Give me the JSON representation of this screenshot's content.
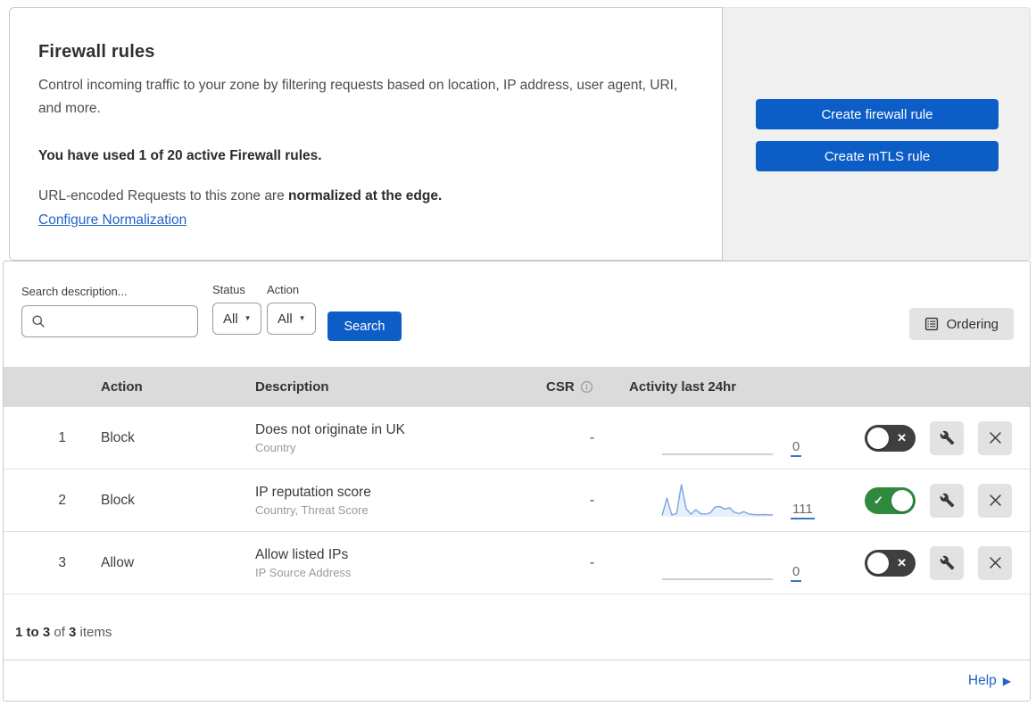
{
  "intro": {
    "title": "Firewall rules",
    "description": "Control incoming traffic to your zone by filtering requests based on location, IP address, user agent, URI, and more.",
    "usage_bold": "You have used 1 of 20 active Firewall rules.",
    "normalization_prefix": "URL-encoded Requests to this zone are ",
    "normalization_bold": "normalized at the edge.",
    "normalization_link": "Configure Normalization"
  },
  "actions_panel": {
    "create_firewall_label": "Create firewall rule",
    "create_mtls_label": "Create mTLS rule"
  },
  "filters": {
    "search_label": "Search description...",
    "status_label": "Status",
    "status_value": "All",
    "action_label": "Action",
    "action_value": "All",
    "search_button_label": "Search",
    "ordering_button_label": "Ordering"
  },
  "table": {
    "headers": {
      "action": "Action",
      "description": "Description",
      "csr": "CSR",
      "activity": "Activity last 24hr"
    },
    "rows": [
      {
        "index": "1",
        "action": "Block",
        "description": "Does not originate in UK",
        "criteria": "Country",
        "csr": "-",
        "activity_count": "0",
        "enabled": false,
        "sparkline": null
      },
      {
        "index": "2",
        "action": "Block",
        "description": "IP reputation score",
        "criteria": "Country, Threat Score",
        "csr": "-",
        "activity_count": "111",
        "enabled": true,
        "sparkline": [
          4,
          58,
          6,
          10,
          100,
          25,
          8,
          22,
          10,
          8,
          12,
          30,
          32,
          24,
          28,
          14,
          10,
          16,
          9,
          7,
          6,
          7,
          6,
          6
        ]
      },
      {
        "index": "3",
        "action": "Allow",
        "description": "Allow listed IPs",
        "criteria": "IP Source Address",
        "csr": "-",
        "activity_count": "0",
        "enabled": false,
        "sparkline": null
      }
    ]
  },
  "footer": {
    "range_bold": "1 to 3",
    "of_text": " of ",
    "total_bold": "3",
    "items_text": " items",
    "help_label": "Help"
  },
  "icons": {
    "caret_down": "▼",
    "help_arrow": "▶",
    "toggle_on_check": "✓",
    "toggle_off_x": "✕"
  },
  "colors": {
    "accent_blue": "#0d5dc7",
    "link_blue": "#1f64c8",
    "toggle_on_green": "#2f8a3e",
    "toggle_off_gray": "#3f3f3f",
    "sparkline_blue": "#7aa5e6",
    "table_header_gray": "#dbdbdb"
  }
}
